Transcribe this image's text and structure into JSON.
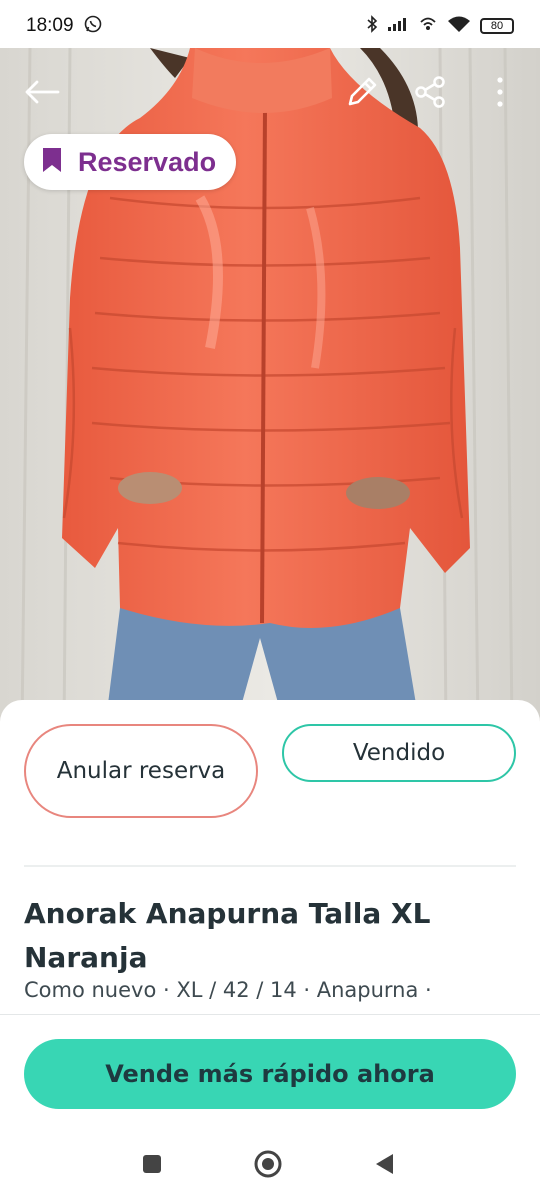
{
  "status_bar": {
    "time": "18:09",
    "battery": "80",
    "icons": [
      "whatsapp-icon",
      "bluetooth-icon",
      "signal-icon",
      "hotspot-icon",
      "wifi-icon",
      "battery-icon"
    ]
  },
  "header": {
    "back_icon": "arrow-left-icon",
    "edit_icon": "pencil-icon",
    "share_icon": "share-icon",
    "more_icon": "more-vertical-icon"
  },
  "badge": {
    "label": "Reservado",
    "icon": "bookmark-icon",
    "color": "#7d2f8f"
  },
  "actions": {
    "cancel_reservation": "Anular reserva",
    "sold": "Vendido"
  },
  "item": {
    "title": "Anorak Anapurna Talla XL Naranja",
    "details": "Como nuevo · XL / 42 / 14 · Anapurna ·"
  },
  "cta": {
    "label": "Vende más rápido ahora",
    "color": "#38d6b4"
  },
  "colors": {
    "reserve_border": "#e8867e",
    "sold_border": "#2ec6a7",
    "jacket": "#f0694c"
  }
}
